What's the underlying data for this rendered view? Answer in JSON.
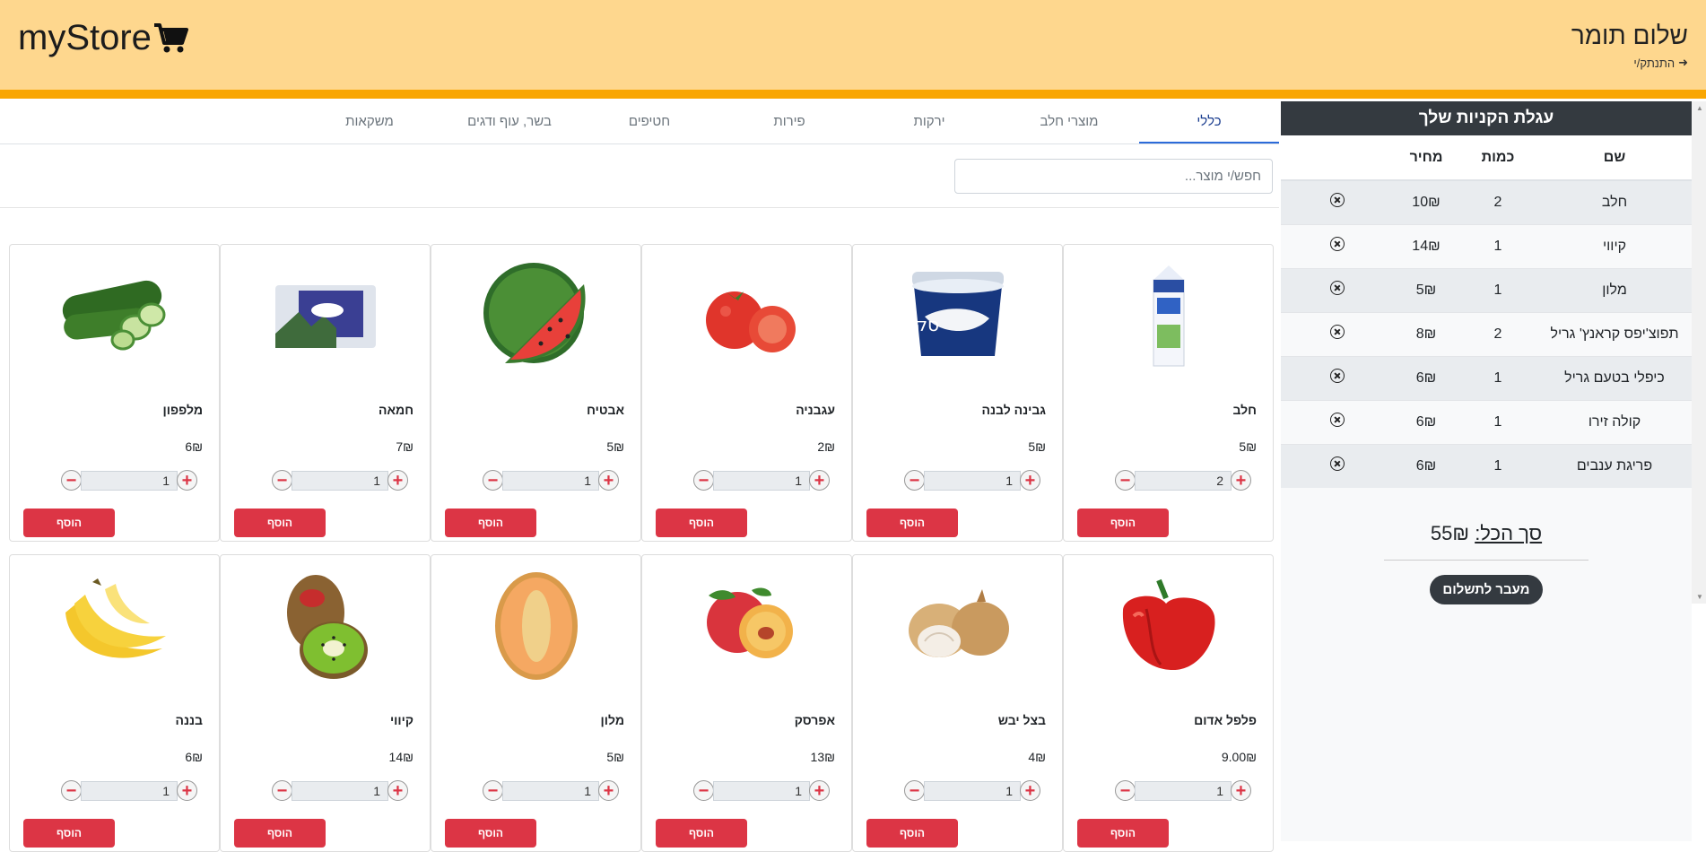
{
  "header": {
    "logo": "myStore",
    "greeting": "שלום תומר",
    "logout": "התנתק/י"
  },
  "tabs": [
    "כללי",
    "מוצרי חלב",
    "ירקות",
    "פירות",
    "חטיפים",
    "בשר, עוף ודגים",
    "משקאות"
  ],
  "search": {
    "placeholder": "חפש/י מוצר..."
  },
  "cart": {
    "title": "עגלת הקניות שלך",
    "headers": {
      "name": "שם",
      "qty": "כמות",
      "price": "מחיר"
    },
    "items": [
      {
        "name": "חלב",
        "qty": "2",
        "price": "10₪"
      },
      {
        "name": "קיווי",
        "qty": "1",
        "price": "14₪"
      },
      {
        "name": "מלון",
        "qty": "1",
        "price": "5₪"
      },
      {
        "name": "תפוצ'יפס קראנץ' גריל",
        "qty": "2",
        "price": "8₪"
      },
      {
        "name": "כיפלי בטעם גריל",
        "qty": "1",
        "price": "6₪"
      },
      {
        "name": "קולה זירו",
        "qty": "1",
        "price": "6₪"
      },
      {
        "name": "פריגת ענבים",
        "qty": "1",
        "price": "6₪"
      }
    ],
    "total_label": "סך הכל:",
    "total_value": "55₪",
    "checkout": "מעבר לתשלום"
  },
  "add_label": "הוסף",
  "products": [
    {
      "name": "חלב",
      "price": "5₪",
      "qty": "2",
      "icon": "milk-carton-icon"
    },
    {
      "name": "גבינה לבנה",
      "price": "5₪",
      "qty": "1",
      "icon": "cheese-cup-icon"
    },
    {
      "name": "עגבניה",
      "price": "2₪",
      "qty": "1",
      "icon": "tomato-icon"
    },
    {
      "name": "אבטיח",
      "price": "5₪",
      "qty": "1",
      "icon": "watermelon-icon"
    },
    {
      "name": "חמאה",
      "price": "7₪",
      "qty": "1",
      "icon": "butter-icon"
    },
    {
      "name": "מלפפון",
      "price": "6₪",
      "qty": "1",
      "icon": "cucumber-icon"
    },
    {
      "name": "פלפל אדום",
      "price": "9.00₪",
      "qty": "1",
      "icon": "red-pepper-icon"
    },
    {
      "name": "בצל יבש",
      "price": "4₪",
      "qty": "1",
      "icon": "onion-icon"
    },
    {
      "name": "אפרסק",
      "price": "13₪",
      "qty": "1",
      "icon": "peach-icon"
    },
    {
      "name": "מלון",
      "price": "5₪",
      "qty": "1",
      "icon": "melon-icon"
    },
    {
      "name": "קיווי",
      "price": "14₪",
      "qty": "1",
      "icon": "kiwi-icon"
    },
    {
      "name": "בננה",
      "price": "6₪",
      "qty": "1",
      "icon": "banana-icon"
    }
  ],
  "colors": {
    "header_bg": "#fed78e",
    "header_border": "#f9a602",
    "add_button": "#dc3545",
    "cart_title_bg": "#343a40"
  }
}
